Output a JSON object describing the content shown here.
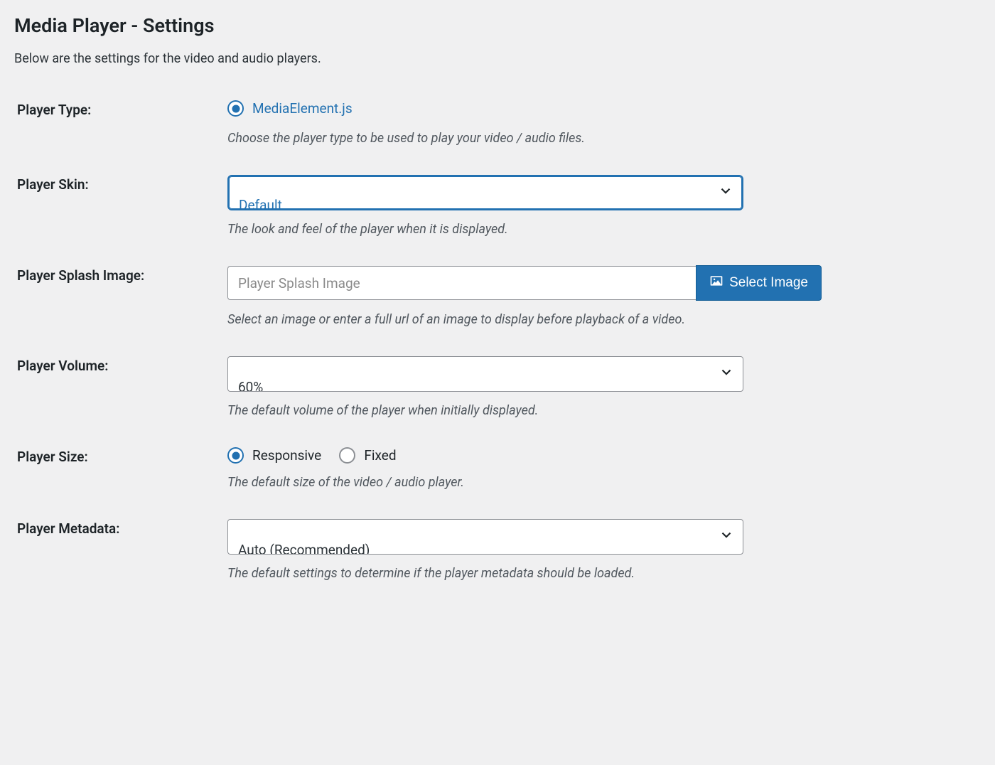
{
  "page": {
    "title": "Media Player - Settings",
    "description": "Below are the settings for the video and audio players."
  },
  "fields": {
    "player_type": {
      "label": "Player Type:",
      "option1": "MediaElement.js",
      "help": "Choose the player type to be used to play your video / audio files."
    },
    "player_skin": {
      "label": "Player Skin:",
      "value": "Default",
      "help": "The look and feel of the player when it is displayed."
    },
    "splash": {
      "label": "Player Splash Image:",
      "placeholder": "Player Splash Image",
      "button": "Select Image",
      "help": "Select an image or enter a full url of an image to display before playback of a video."
    },
    "volume": {
      "label": "Player Volume:",
      "value": "60%",
      "help": "The default volume of the player when initially displayed."
    },
    "size": {
      "label": "Player Size:",
      "option1": "Responsive",
      "option2": "Fixed",
      "help": "The default size of the video / audio player."
    },
    "metadata": {
      "label": "Player Metadata:",
      "value": "Auto (Recommended)",
      "help": "The default settings to determine if the player metadata should be loaded."
    }
  }
}
